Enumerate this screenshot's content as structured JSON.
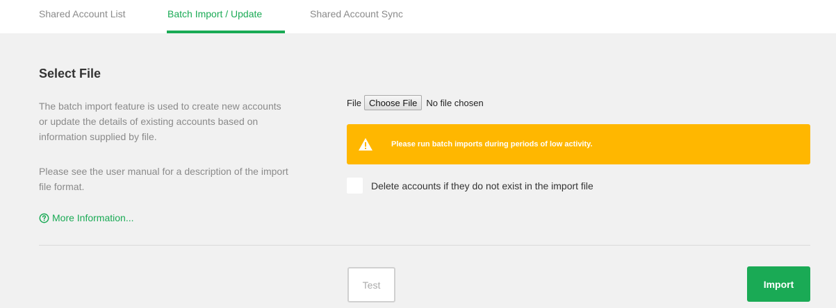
{
  "tabs": [
    {
      "label": "Shared Account List",
      "active": false
    },
    {
      "label": "Batch Import / Update",
      "active": true
    },
    {
      "label": "Shared Account Sync",
      "active": false
    }
  ],
  "section": {
    "title": "Select File",
    "description_1": "The batch import feature is used to create new accounts or update the details of existing accounts based on information supplied by file.",
    "description_2": "Please see the user manual for a description of the import file format.",
    "more_info_label": "More Information..."
  },
  "file_input": {
    "label": "File",
    "button_label": "Choose File",
    "status": "No file chosen"
  },
  "alert": {
    "icon": "warning-icon",
    "text": "Please run batch imports during periods of low activity.",
    "color": "#ffb700"
  },
  "delete_option": {
    "label": "Delete accounts if they do not exist in the import file",
    "checked": false
  },
  "actions": {
    "test_label": "Test",
    "import_label": "Import"
  },
  "colors": {
    "accent": "#1aaa55",
    "panel_bg": "#f1f1f1",
    "warning": "#ffb700"
  }
}
